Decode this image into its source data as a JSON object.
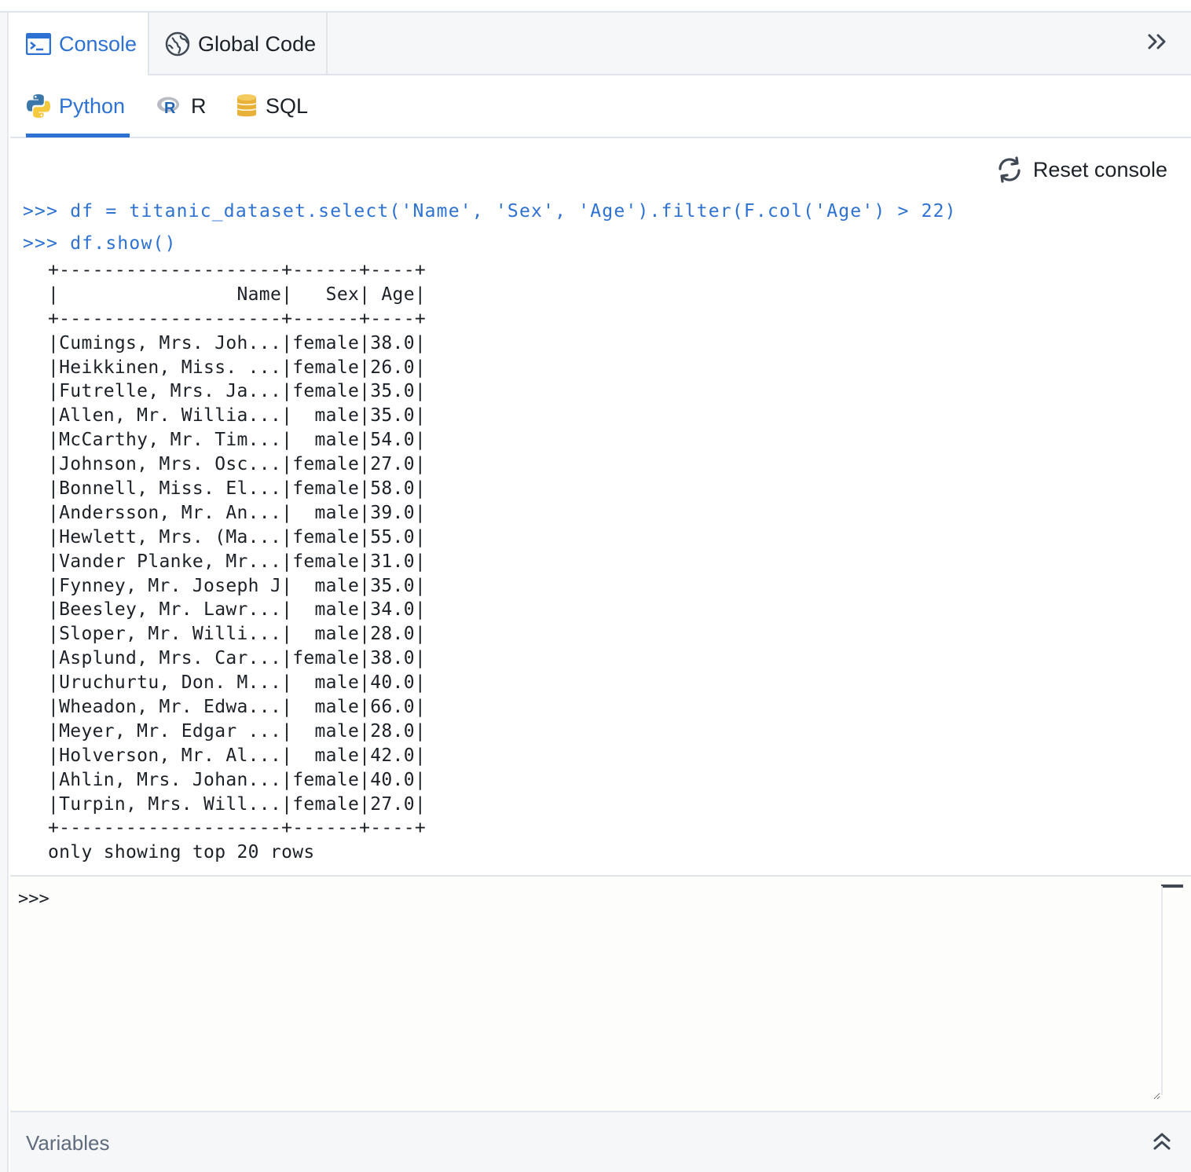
{
  "tabs": {
    "console": "Console",
    "global_code": "Global Code"
  },
  "languages": {
    "python": "Python",
    "r": "R",
    "sql": "SQL",
    "active": "Python"
  },
  "toolbar": {
    "reset_label": "Reset console"
  },
  "history": {
    "command_1": ">>> df = titanic_dataset.select('Name', 'Sex', 'Age').filter(F.col('Age') > 22)",
    "command_2": ">>> df.show()"
  },
  "output": {
    "lines": [
      "+--------------------+------+----+",
      "|                Name|   Sex| Age|",
      "+--------------------+------+----+",
      "|Cumings, Mrs. Joh...|female|38.0|",
      "|Heikkinen, Miss. ...|female|26.0|",
      "|Futrelle, Mrs. Ja...|female|35.0|",
      "|Allen, Mr. Willia...|  male|35.0|",
      "|McCarthy, Mr. Tim...|  male|54.0|",
      "|Johnson, Mrs. Osc...|female|27.0|",
      "|Bonnell, Miss. El...|female|58.0|",
      "|Andersson, Mr. An...|  male|39.0|",
      "|Hewlett, Mrs. (Ma...|female|55.0|",
      "|Vander Planke, Mr...|female|31.0|",
      "|Fynney, Mr. Joseph J|  male|35.0|",
      "|Beesley, Mr. Lawr...|  male|34.0|",
      "|Sloper, Mr. Willi...|  male|28.0|",
      "|Asplund, Mrs. Car...|female|38.0|",
      "|Uruchurtu, Don. M...|  male|40.0|",
      "|Wheadon, Mr. Edwa...|  male|66.0|",
      "|Meyer, Mr. Edgar ...|  male|28.0|",
      "|Holverson, Mr. Al...|  male|42.0|",
      "|Ahlin, Mrs. Johan...|female|40.0|",
      "|Turpin, Mrs. Will...|female|27.0|",
      "+--------------------+------+----+",
      "only showing top 20 rows"
    ]
  },
  "input": {
    "prompt": ">>>",
    "value": ""
  },
  "footer": {
    "variables_label": "Variables"
  },
  "icons": {
    "console": "terminal-icon",
    "global_code": "globe-icon",
    "collapse": "double-chevron-right-icon",
    "python": "python-logo-icon",
    "r": "r-logo-icon",
    "sql": "database-icon",
    "reset": "refresh-icon",
    "expand": "double-chevron-up-icon"
  },
  "colors": {
    "accent": "#2d72d2",
    "text": "#1c2127",
    "muted": "#5f6b7c",
    "panel": "#f6f7f9",
    "sql_icon": "#e8b23a"
  }
}
